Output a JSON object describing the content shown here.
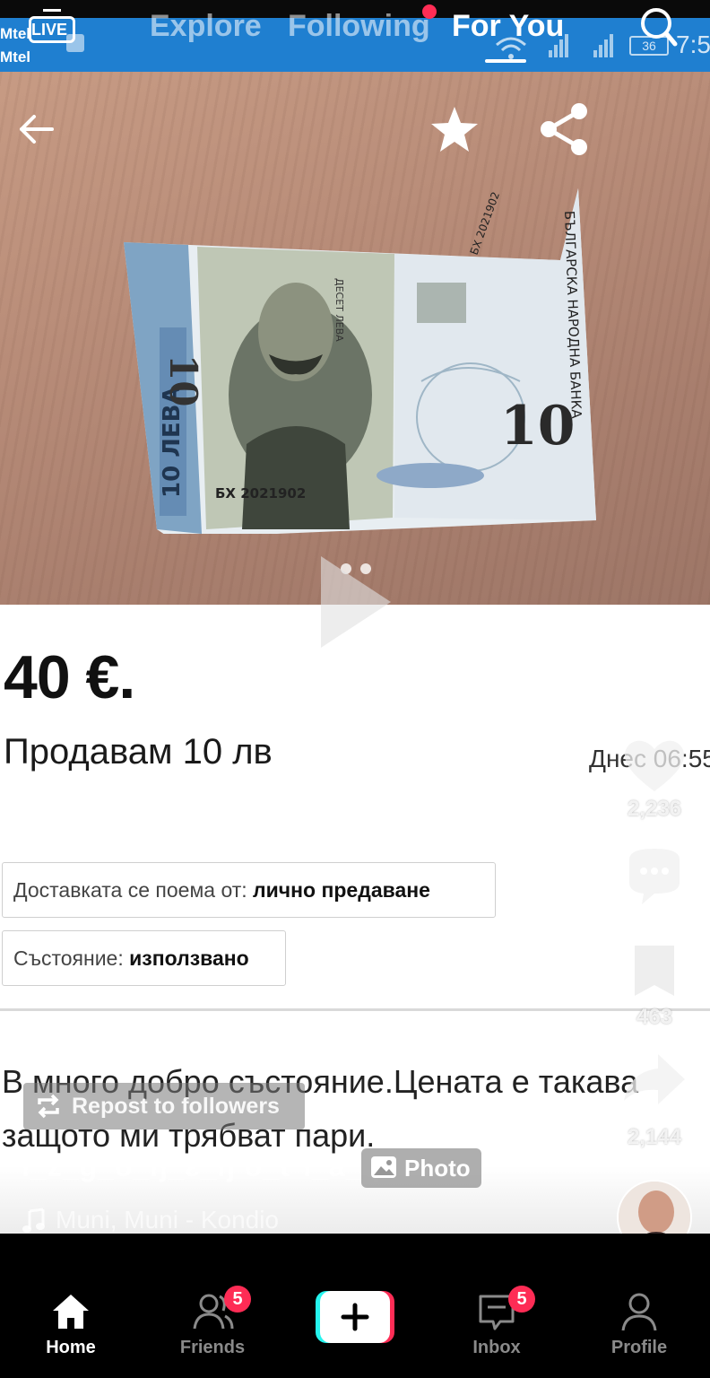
{
  "status_bar": {
    "carrier_1": "Mtel",
    "carrier_2": "Mtel",
    "battery": "36",
    "time": "7:5"
  },
  "top_nav": {
    "live_label": "LIVE",
    "tabs": [
      {
        "label": "Explore"
      },
      {
        "label": "Following"
      },
      {
        "label": "For You"
      }
    ],
    "active_tab": "For You"
  },
  "listing": {
    "price": "40 €.",
    "title": "Продавам 10 лв",
    "date": "Днес 06:55",
    "delivery_label": "Доставката се поема от:",
    "delivery_value": "лично предаване",
    "condition_label": "Състояние:",
    "condition_value": "използвано",
    "description": "В много добро състояние.Цената е такава защото ми трябват пари."
  },
  "photo": {
    "slide_count": 2,
    "active_slide": 2
  },
  "overlay": {
    "repost_label": "Repost to followers",
    "username": "i_ž_ğ_ö_ŋ_ɛ_ŋ  ö_ť  ĩ_ä_q",
    "photo_badge": "Photo",
    "music": "Muni, Muni - Kondio"
  },
  "actions": {
    "likes": "2,236",
    "saves": "463",
    "shares": "2,144"
  },
  "bottom_nav": {
    "items": [
      {
        "label": "Home"
      },
      {
        "label": "Friends",
        "badge": "5"
      },
      {
        "label": "Inbox",
        "badge": "5"
      },
      {
        "label": "Profile"
      }
    ]
  },
  "colors": {
    "top_bar": "#1f7fd0",
    "badge": "#fe2c55",
    "create_cyan": "#25f4ee",
    "create_pink": "#fe2c55"
  },
  "icons": [
    "back-arrow-icon",
    "star-icon",
    "share-icon",
    "search-icon",
    "heart-icon",
    "comment-icon",
    "bookmark-icon",
    "forward-icon",
    "home-icon",
    "friends-icon",
    "plus-icon",
    "inbox-icon",
    "profile-icon",
    "music-note-icon",
    "repost-icon",
    "photo-icon",
    "play-icon"
  ]
}
